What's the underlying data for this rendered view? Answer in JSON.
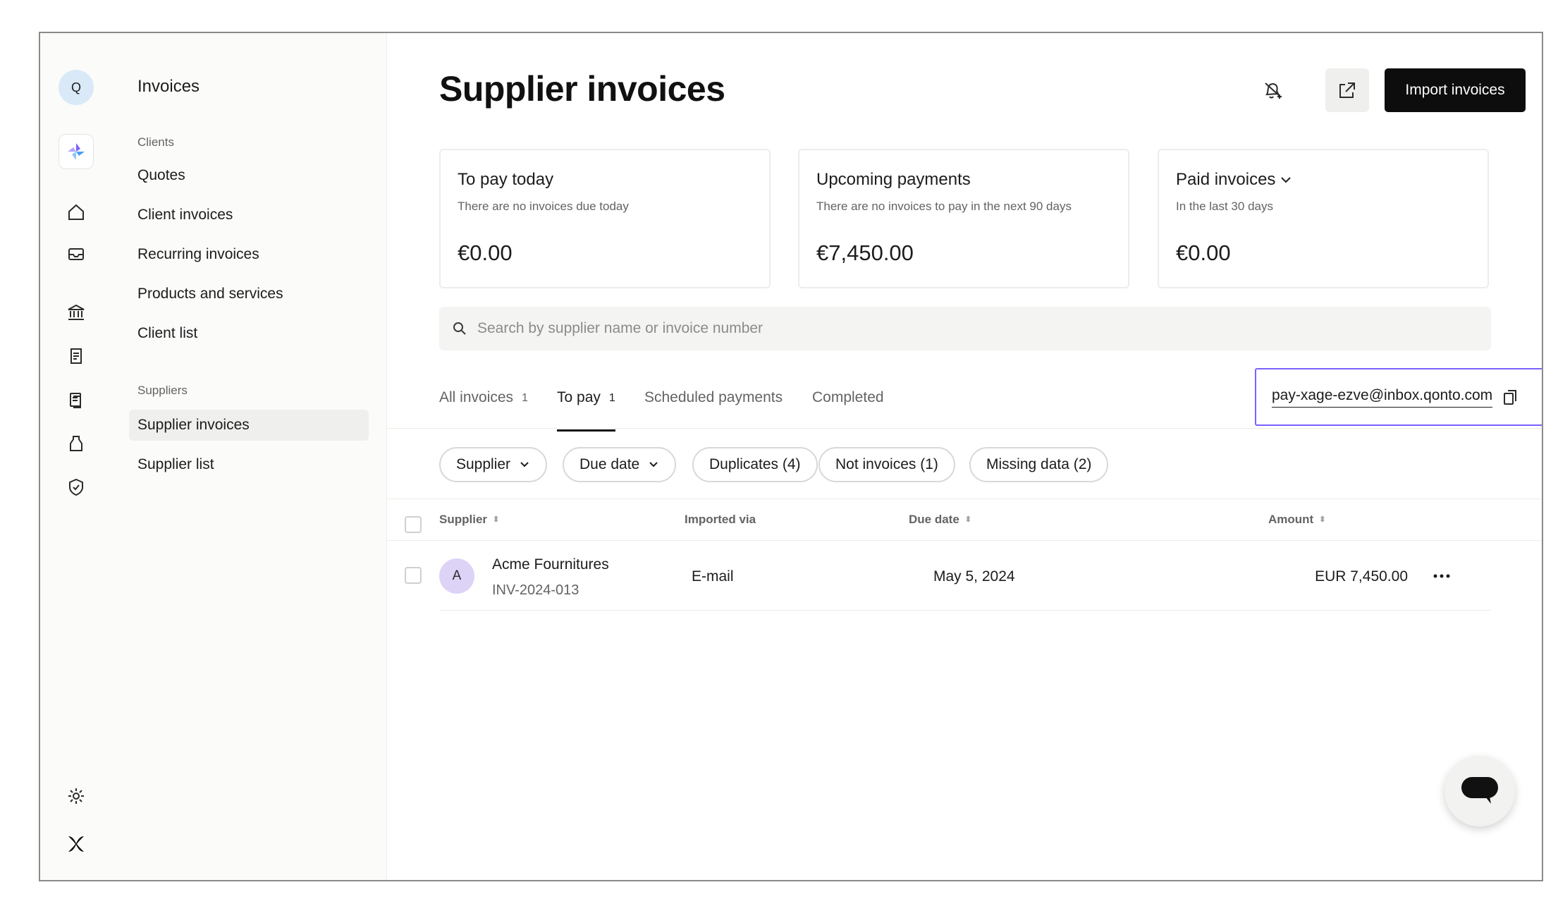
{
  "rail": {
    "avatar_letter": "Q",
    "icons": [
      "home-icon",
      "inbox-icon",
      "bank-icon",
      "receipt-icon",
      "documents-icon",
      "savings-jar-icon",
      "shield-check-icon",
      "settings-gear-icon",
      "qonto-logo-icon"
    ]
  },
  "subnav": {
    "title": "Invoices",
    "clients_group": "Clients",
    "clients_items": [
      "Quotes",
      "Client invoices",
      "Recurring invoices",
      "Products and services",
      "Client list"
    ],
    "suppliers_group": "Suppliers",
    "suppliers_items": [
      "Supplier invoices",
      "Supplier list"
    ]
  },
  "header": {
    "title": "Supplier invoices",
    "import_label": "Import invoices"
  },
  "cards": [
    {
      "title": "To pay today",
      "subtitle": "There are no invoices due today",
      "amount": "€0.00"
    },
    {
      "title": "Upcoming payments",
      "subtitle": "There are no invoices to pay in the next 90 days",
      "amount": "€7,450.00"
    },
    {
      "title": "Paid invoices",
      "subtitle": "In the last 30 days",
      "amount": "€0.00"
    }
  ],
  "search": {
    "placeholder": "Search by supplier name or invoice number"
  },
  "tabs": [
    {
      "label": "All invoices",
      "count": "1"
    },
    {
      "label": "To pay",
      "count": "1"
    },
    {
      "label": "Scheduled payments",
      "count": ""
    },
    {
      "label": "Completed",
      "count": ""
    }
  ],
  "inbox_email": "pay-xage-ezve@inbox.qonto.com",
  "filters": [
    "Supplier",
    "Due date",
    "Duplicates (4)",
    "Not invoices (1)",
    "Missing data (2)"
  ],
  "table": {
    "columns": [
      "Supplier",
      "Imported via",
      "Due date",
      "Amount"
    ],
    "rows": [
      {
        "avatar": "A",
        "supplier": "Acme Fournitures",
        "invoice_number": "INV-2024-013",
        "imported_via": "E-mail",
        "due_date": "May 5, 2024",
        "amount": "EUR 7,450.00"
      }
    ]
  },
  "colors": {
    "primary_button": "#0d0d0d",
    "accent_outline": "#7b61ff",
    "avatar_q": "#d9e9f7",
    "avatar_a": "#ddd3f7"
  }
}
